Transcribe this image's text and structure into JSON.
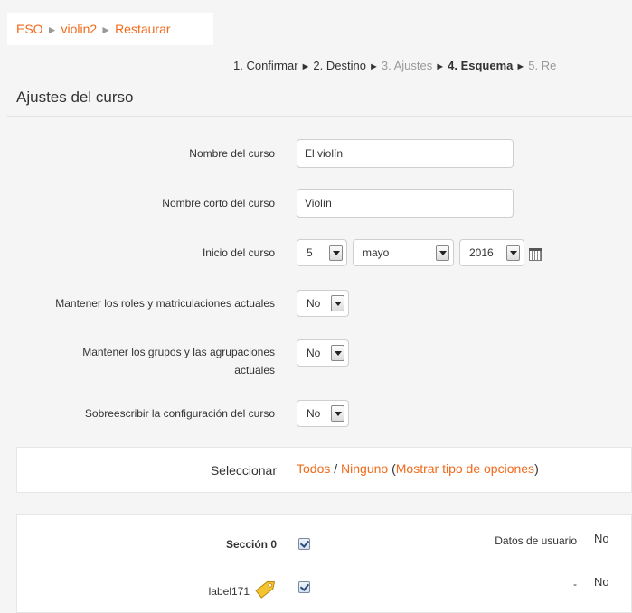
{
  "breadcrumb": {
    "items": [
      "ESO",
      "violin2",
      "Restaurar"
    ],
    "separator": "►"
  },
  "steps": [
    {
      "label": "1. Confirmar",
      "state": "done"
    },
    {
      "label": "2. Destino",
      "state": "done"
    },
    {
      "label": "3. Ajustes",
      "state": "dim"
    },
    {
      "label": "4. Esquema",
      "state": "current"
    },
    {
      "label": "5. Re",
      "state": "dim"
    }
  ],
  "step_arrow": "►",
  "page_title": "Ajustes del curso",
  "form": {
    "course_name_label": "Nombre del curso",
    "course_name_value": "El violín",
    "short_name_label": "Nombre corto del curso",
    "short_name_value": "Violín",
    "start_label": "Inicio del curso",
    "start_day": "5",
    "start_month": "mayo",
    "start_year": "2016",
    "keep_roles_label": "Mantener los roles y matriculaciones actuales",
    "keep_roles_value": "No",
    "keep_groups_label_1": "Mantener los grupos y las agrupaciones",
    "keep_groups_label_2": "actuales",
    "keep_groups_value": "No",
    "overwrite_label": "Sobreescribir la configuración del curso",
    "overwrite_value": "No"
  },
  "select_panel": {
    "label": "Seleccionar",
    "all": "Todos",
    "slash": " / ",
    "none": "Ninguno",
    "paren_open": " (",
    "show_options": "Mostrar tipo de opciones",
    "paren_close": ")"
  },
  "sections": [
    {
      "name": "Sección 0",
      "col_label": "Datos de usuario",
      "col_value": "No",
      "checked": true
    },
    {
      "name": "label171",
      "col_label": "-",
      "col_value": "No",
      "checked": true
    }
  ],
  "colors": {
    "accent": "#f26a1b",
    "background": "#f5f5f5"
  }
}
